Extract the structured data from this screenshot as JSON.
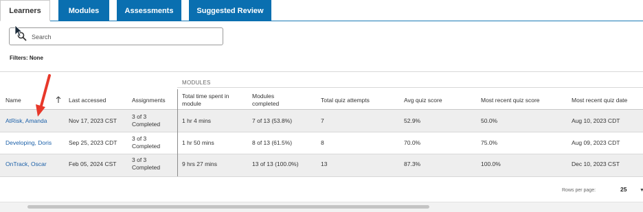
{
  "tabs": [
    {
      "label": "Learners",
      "active": true
    },
    {
      "label": "Modules",
      "active": false
    },
    {
      "label": "Assessments",
      "active": false
    },
    {
      "label": "Suggested Review",
      "active": false
    }
  ],
  "search": {
    "placeholder": "Search",
    "value": ""
  },
  "filters": {
    "label": "Filters: None"
  },
  "table": {
    "group_label": "MODULES",
    "columns": {
      "name": "Name",
      "last_accessed": "Last accessed",
      "assignments": "Assignments",
      "total_time": "Total time spent in module",
      "modules_completed": "Modules completed",
      "total_quiz_attempts": "Total quiz attempts",
      "avg_quiz_score": "Avg quiz score",
      "recent_quiz_score": "Most recent quiz score",
      "recent_quiz_date": "Most recent quiz date"
    },
    "rows": [
      {
        "name": "AtRisk, Amanda",
        "last_accessed": "Nov 17, 2023 CST",
        "assignments": "3 of 3 Completed",
        "total_time": "1 hr 4 mins",
        "modules_completed": "7 of 13 (53.8%)",
        "total_quiz_attempts": "7",
        "avg_quiz_score": "52.9%",
        "recent_quiz_score": "50.0%",
        "recent_quiz_date": "Aug 10, 2023 CDT"
      },
      {
        "name": "Developing, Doris",
        "last_accessed": "Sep 25, 2023 CDT",
        "assignments": "3 of 3 Completed",
        "total_time": "1 hr 50 mins",
        "modules_completed": "8 of 13 (61.5%)",
        "total_quiz_attempts": "8",
        "avg_quiz_score": "70.0%",
        "recent_quiz_score": "75.0%",
        "recent_quiz_date": "Aug 09, 2023 CDT"
      },
      {
        "name": "OnTrack, Oscar",
        "last_accessed": "Feb 05, 2024 CST",
        "assignments": "3 of 3 Completed",
        "total_time": "9 hrs 27 mins",
        "modules_completed": "13 of 13 (100.0%)",
        "total_quiz_attempts": "13",
        "avg_quiz_score": "87.3%",
        "recent_quiz_score": "100.0%",
        "recent_quiz_date": "Dec 10, 2023 CST"
      }
    ]
  },
  "pagination": {
    "rows_per_page_label": "Rows per page:",
    "rows_per_page_value": "25"
  },
  "colors": {
    "tab_active_bg": "#ffffff",
    "tab_inactive_bg": "#0a6fb0",
    "link": "#1a5fa8",
    "annotation_arrow": "#e8382a",
    "row_alt_bg": "#eeeeee"
  },
  "icons": {
    "search": "search-icon",
    "sort": "arrow-up-icon",
    "dropdown": "chevron-down-icon",
    "annotation": "red-arrow-annotation"
  }
}
